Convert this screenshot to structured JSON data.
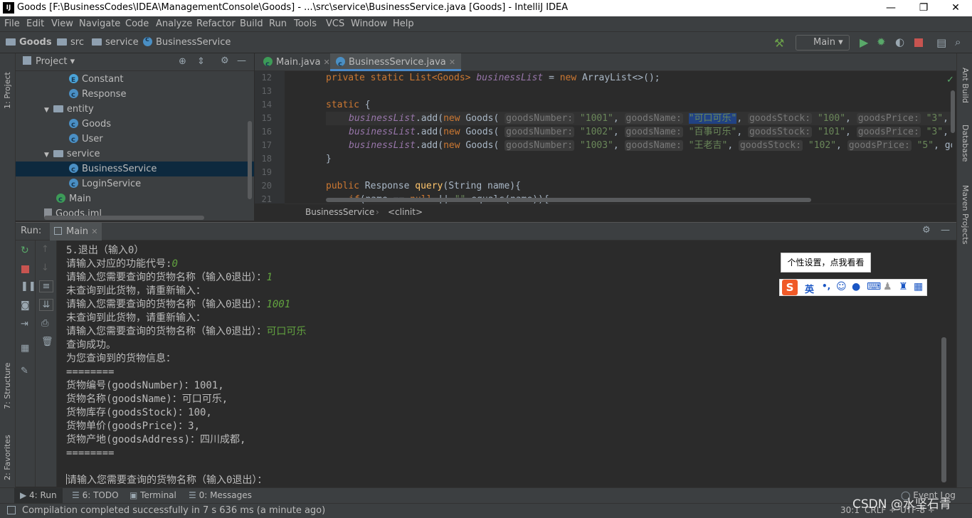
{
  "titlebar": {
    "logo": "IJ",
    "title": "Goods [F:\\BusinessCodes\\IDEA\\ManagementConsole\\Goods] - ...\\src\\service\\BusinessService.java [Goods] - IntelliJ IDEA",
    "minimize": "—",
    "restore": "❐",
    "close": "✕"
  },
  "menu": [
    "File",
    "Edit",
    "View",
    "Navigate",
    "Code",
    "Analyze",
    "Refactor",
    "Build",
    "Run",
    "Tools",
    "VCS",
    "Window",
    "Help"
  ],
  "nav": {
    "project": "Goods",
    "src": "src",
    "service": "service",
    "file": "BusinessService",
    "run_config": "Main"
  },
  "strip_left": {
    "project": "1: Project",
    "structure": "7: Structure",
    "favorites": "2: Favorites"
  },
  "strip_right": {
    "ant": "Ant Build",
    "database": "Database",
    "maven": "Maven Projects"
  },
  "project": {
    "header": "Project",
    "items": [
      {
        "label": "Constant",
        "type": "enum"
      },
      {
        "label": "Response",
        "type": "class"
      },
      {
        "label": "entity",
        "type": "folder"
      },
      {
        "label": "Goods",
        "type": "class"
      },
      {
        "label": "User",
        "type": "class"
      },
      {
        "label": "service",
        "type": "folder"
      },
      {
        "label": "BusinessService",
        "type": "class"
      },
      {
        "label": "LoginService",
        "type": "class"
      },
      {
        "label": "Main",
        "type": "main"
      },
      {
        "label": "Goods.iml",
        "type": "file"
      }
    ]
  },
  "editor": {
    "tabs": [
      {
        "label": "Main.java"
      },
      {
        "label": "BusinessService.java"
      }
    ],
    "line_numbers": [
      "12",
      "13",
      "14",
      "15",
      "16",
      "17",
      "18",
      "19",
      "20",
      "21"
    ],
    "code": {
      "l12a": "private static List<Goods> ",
      "l12b": "businessList",
      "l12c": " = ",
      "l12d": "new",
      "l12e": " ArrayList<>();",
      "l14a": "static",
      "l14b": " {",
      "add": "businessList",
      "dotadd": ".add(",
      "new": "new",
      "goods": " Goods( ",
      "h_num": "goodsNumber:",
      "h_name": "goodsName:",
      "h_stock": "goodsStock:",
      "h_price": "goodsPrice:",
      "r1": {
        "num": "\"1001\"",
        "name": "\"可口可乐\"",
        "stock": "\"100\"",
        "price": "\"3\"",
        "tail": ", g"
      },
      "r2": {
        "num": "\"1002\"",
        "name": "\"百事可乐\"",
        "stock": "\"101\"",
        "price": "\"3\"",
        "tail": ", g"
      },
      "r3": {
        "num": "\"1003\"",
        "name": "\"王老吉\"",
        "stock": "\"102\"",
        "price": "\"5\"",
        "tail": ", goo"
      },
      "l17": "}",
      "l20a": "public",
      "l20b": " Response ",
      "l20c": "query",
      "l20d": "(String name){",
      "l21a": "if",
      "l21b": "(name == ",
      "l21c": "null",
      "l21d": " || ",
      "l21e": "\"\"",
      "l21f": ".equals(name)){"
    },
    "breadcrumb": {
      "class": "BusinessService",
      "method": "<clinit>"
    }
  },
  "run": {
    "label": "Run:",
    "tab": "Main"
  },
  "console": [
    {
      "t": "5.退出（输入0）"
    },
    {
      "t": "请输入对应的功能代号:",
      "i": "0"
    },
    {
      "t": "请输入您需要查询的货物名称（输入0退出）：",
      "i": "1"
    },
    {
      "t": "未查询到此货物，请重新输入："
    },
    {
      "t": "请输入您需要查询的货物名称（输入0退出）：",
      "i": "1001"
    },
    {
      "t": "未查询到此货物，请重新输入："
    },
    {
      "t": "请输入您需要查询的货物名称（输入0退出）：",
      "i": "可口可乐"
    },
    {
      "t": "查询成功。"
    },
    {
      "t": "为您查询到的货物信息："
    },
    {
      "t": "========"
    },
    {
      "t": "货物编号(goodsNumber)：1001,"
    },
    {
      "t": "货物名称(goodsName)：可口可乐,"
    },
    {
      "t": "货物库存(goodsStock)：100,"
    },
    {
      "t": "货物单价(goodsPrice)：3,"
    },
    {
      "t": "货物产地(goodsAddress)：四川成都,"
    },
    {
      "t": "========"
    },
    {
      "t": ""
    },
    {
      "t": "请输入您需要查询的货物名称（输入0退出）："
    }
  ],
  "ime": {
    "tip": "个性设置，点我看看",
    "lang": "英",
    "punct": "•,"
  },
  "bottom_tabs": {
    "run": "4: Run",
    "todo": "6: TODO",
    "terminal": "Terminal",
    "messages": "0: Messages",
    "event_log": "Event Log"
  },
  "status": {
    "message": "Compilation completed successfully in 7 s 636 ms (a minute ago)",
    "position": "30:1",
    "line_sep": "CRLF ÷",
    "encoding": "UTF-8 ÷",
    "watermark": "CSDN @水坚石青"
  }
}
